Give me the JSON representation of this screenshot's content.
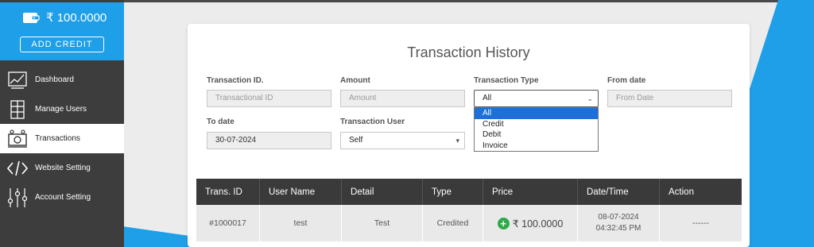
{
  "wallet": {
    "balance": "₹ 100.0000",
    "add_credit_label": "ADD CREDIT"
  },
  "nav": {
    "items": [
      {
        "label": "Dashboard",
        "icon": "chart-icon"
      },
      {
        "label": "Manage Users",
        "icon": "users-icon"
      },
      {
        "label": "Transactions",
        "icon": "transactions-icon",
        "active": true
      },
      {
        "label": "Website Setting",
        "icon": "code-icon"
      },
      {
        "label": "Account Setting",
        "icon": "sliders-icon"
      }
    ]
  },
  "page": {
    "title": "Transaction History"
  },
  "filters": {
    "trans_id": {
      "label": "Transaction ID.",
      "placeholder": "Transactional ID"
    },
    "amount": {
      "label": "Amount",
      "placeholder": "Amount"
    },
    "trans_type": {
      "label": "Transaction Type",
      "value": "All",
      "options": [
        "All",
        "Credit",
        "Debit",
        "Invoice"
      ]
    },
    "from_date": {
      "label": "From date",
      "placeholder": "From Date"
    },
    "to_date": {
      "label": "To date",
      "value": "30-07-2024"
    },
    "trans_user": {
      "label": "Transaction User",
      "value": "Self"
    }
  },
  "table": {
    "headers": [
      "Trans. ID",
      "User Name",
      "Detail",
      "Type",
      "Price",
      "Date/Time",
      "Action"
    ],
    "rows": [
      {
        "id": "#1000017",
        "user": "test",
        "detail": "Test",
        "type": "Credited",
        "price": "₹ 100.0000",
        "date": "08-07-2024",
        "time": "04:32:45 PM",
        "action": "------"
      }
    ]
  },
  "colors": {
    "accent": "#1e9fe8",
    "sidebar": "#3d3d3d",
    "table_header": "#3a3a3a",
    "credit_green": "#2eaa4a"
  }
}
